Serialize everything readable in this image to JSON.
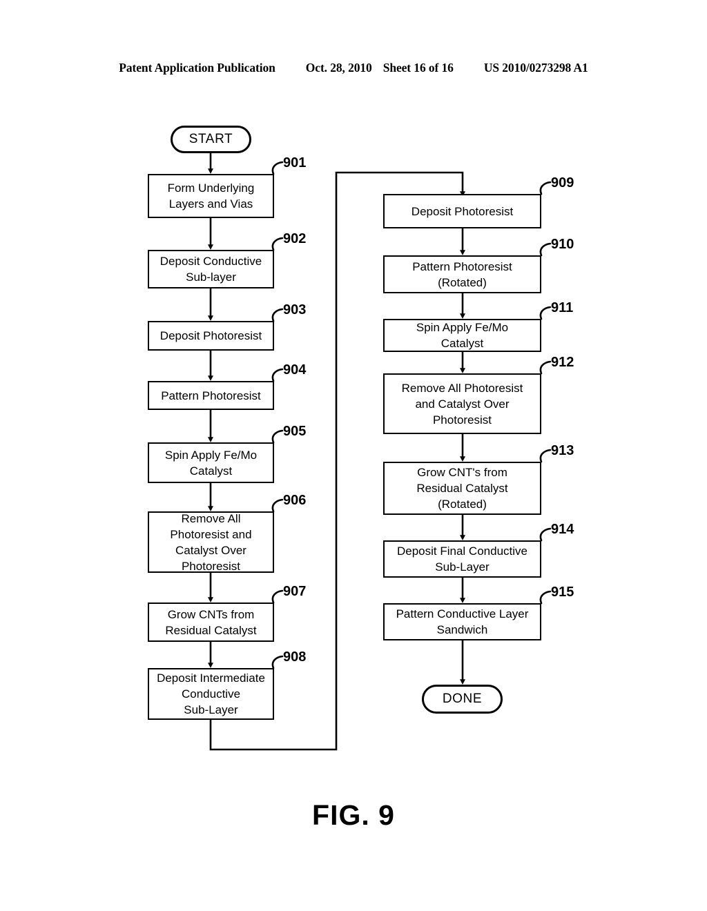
{
  "header": {
    "publication": "Patent Application Publication",
    "date": "Oct. 28, 2010",
    "sheet": "Sheet 16 of 16",
    "patent_number": "US 2010/0273298 A1"
  },
  "caption": "FIG. 9",
  "flowchart": {
    "start_label": "START",
    "done_label": "DONE",
    "nodes": [
      {
        "ref": "901",
        "text": "Form Underlying\nLayers and Vias"
      },
      {
        "ref": "902",
        "text": "Deposit Conductive\nSub-layer"
      },
      {
        "ref": "903",
        "text": "Deposit Photoresist"
      },
      {
        "ref": "904",
        "text": "Pattern Photoresist"
      },
      {
        "ref": "905",
        "text": "Spin Apply Fe/Mo\nCatalyst"
      },
      {
        "ref": "906",
        "text": "Remove All\nPhotoresist and\nCatalyst Over\nPhotoresist"
      },
      {
        "ref": "907",
        "text": "Grow CNTs from\nResidual Catalyst"
      },
      {
        "ref": "908",
        "text": "Deposit Intermediate\nConductive\nSub-Layer"
      },
      {
        "ref": "909",
        "text": "Deposit Photoresist"
      },
      {
        "ref": "910",
        "text": "Pattern Photoresist\n(Rotated)"
      },
      {
        "ref": "911",
        "text": "Spin Apply Fe/Mo\nCatalyst"
      },
      {
        "ref": "912",
        "text": "Remove All Photoresist\nand Catalyst Over\nPhotoresist"
      },
      {
        "ref": "913",
        "text": "Grow CNT's from\nResidual Catalyst\n(Rotated)"
      },
      {
        "ref": "914",
        "text": "Deposit Final Conductive\nSub-Layer"
      },
      {
        "ref": "915",
        "text": "Pattern Conductive Layer\nSandwich"
      }
    ]
  }
}
